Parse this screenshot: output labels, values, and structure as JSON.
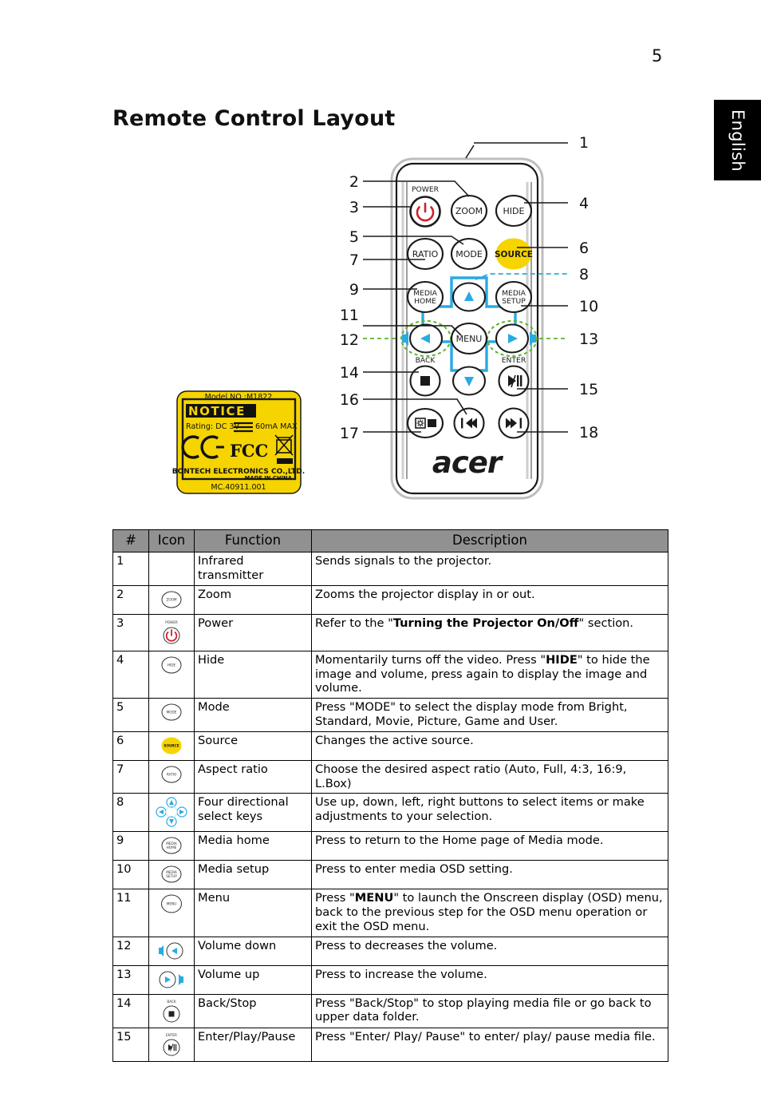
{
  "page": {
    "number": "5",
    "language_tab": "English",
    "title": "Remote Control Layout"
  },
  "figure": {
    "name": "remote-control-diagram",
    "brand_logo": "acer",
    "callouts_left": [
      {
        "n": "2",
        "style": "solid"
      },
      {
        "n": "3",
        "style": "solid"
      },
      {
        "n": "5",
        "style": "solid"
      },
      {
        "n": "7",
        "style": "solid"
      },
      {
        "n": "9",
        "style": "solid"
      },
      {
        "n": "11",
        "style": "solid"
      },
      {
        "n": "12",
        "style": "dashed-green"
      },
      {
        "n": "14",
        "style": "solid"
      },
      {
        "n": "16",
        "style": "solid"
      },
      {
        "n": "17",
        "style": "solid"
      }
    ],
    "callouts_right": [
      {
        "n": "1",
        "style": "solid"
      },
      {
        "n": "4",
        "style": "solid"
      },
      {
        "n": "6",
        "style": "solid"
      },
      {
        "n": "8",
        "style": "dashed-blue"
      },
      {
        "n": "10",
        "style": "solid"
      },
      {
        "n": "13",
        "style": "dashed-green"
      },
      {
        "n": "15",
        "style": "solid"
      },
      {
        "n": "18",
        "style": "solid"
      }
    ],
    "buttons": [
      {
        "label": "POWER",
        "type": "power-icon"
      },
      {
        "label": "ZOOM",
        "type": "text"
      },
      {
        "label": "HIDE",
        "type": "text"
      },
      {
        "label": "RATIO",
        "type": "text"
      },
      {
        "label": "MODE",
        "type": "text"
      },
      {
        "label": "SOURCE",
        "type": "text-yellow"
      },
      {
        "label": "MEDIA HOME",
        "type": "text"
      },
      {
        "label": "MEDIA SETUP",
        "type": "text"
      },
      {
        "label": "MENU",
        "type": "text"
      },
      {
        "label": "BACK",
        "type": "stop-icon"
      },
      {
        "label": "ENTER",
        "type": "play-pause-icon"
      }
    ],
    "colors": {
      "source_button": "#F5D400",
      "power_glyph": "#D0202A",
      "dpad_cyan": "#29AAE2",
      "callout_green": "#5FB22D",
      "callout_blue": "#29AAE2"
    }
  },
  "notice_label": {
    "name": "notice-sticker",
    "model_line": "Model NO :M1822",
    "notice": "NOTICE",
    "rating": "Rating: DC 3V",
    "rating_tail": "60mA MAX",
    "company": "BONTECH ELECTRONICS CO.,LTD.",
    "made_in": "MADE IN CHINA",
    "part_number": "MC.40911.001",
    "marks": [
      "CE",
      "FCC",
      "WEEE"
    ],
    "background": "#F5D400"
  },
  "table": {
    "headers": [
      "#",
      "Icon",
      "Function",
      "Description"
    ],
    "rows": [
      {
        "num": "1",
        "icon": "none",
        "function": "Infrared transmitter",
        "desc_parts": [
          {
            "t": "Sends signals to the projector.",
            "b": false
          }
        ]
      },
      {
        "num": "2",
        "icon": "zoom",
        "function": "Zoom",
        "desc_parts": [
          {
            "t": "Zooms the projector display in or out.",
            "b": false
          }
        ]
      },
      {
        "num": "3",
        "icon": "power",
        "function": "Power",
        "desc_parts": [
          {
            "t": "Refer to the \"",
            "b": false
          },
          {
            "t": "Turning the Projector On/Off",
            "b": true
          },
          {
            "t": "\" section.",
            "b": false
          }
        ]
      },
      {
        "num": "4",
        "icon": "hide",
        "function": "Hide",
        "desc_parts": [
          {
            "t": "Momentarily turns off the video. Press \"",
            "b": false
          },
          {
            "t": "HIDE",
            "b": true
          },
          {
            "t": "\" to hide the image and volume, press again to display the image and volume.",
            "b": false
          }
        ]
      },
      {
        "num": "5",
        "icon": "mode",
        "function": "Mode",
        "desc_parts": [
          {
            "t": "Press \"MODE\" to select the display mode from Bright, Standard, Movie, Picture, Game and User.",
            "b": false
          }
        ]
      },
      {
        "num": "6",
        "icon": "source",
        "function": "Source",
        "desc_parts": [
          {
            "t": "Changes the active source.",
            "b": false
          }
        ]
      },
      {
        "num": "7",
        "icon": "ratio",
        "function": "Aspect ratio",
        "desc_parts": [
          {
            "t": "Choose the desired aspect ratio (Auto, Full, 4:3, 16:9, L.Box)",
            "b": false
          }
        ]
      },
      {
        "num": "8",
        "icon": "dpad",
        "function": "Four directional select keys",
        "desc_parts": [
          {
            "t": "Use up, down, left, right buttons to select items or make adjustments to your selection.",
            "b": false
          }
        ]
      },
      {
        "num": "9",
        "icon": "media-home",
        "function": "Media home",
        "desc_parts": [
          {
            "t": "Press to return to the Home page of Media mode.",
            "b": false
          }
        ]
      },
      {
        "num": "10",
        "icon": "media-setup",
        "function": "Media setup",
        "desc_parts": [
          {
            "t": "Press to enter media OSD setting.",
            "b": false
          }
        ]
      },
      {
        "num": "11",
        "icon": "menu",
        "function": "Menu",
        "desc_parts": [
          {
            "t": "Press \"",
            "b": false
          },
          {
            "t": "MENU",
            "b": true
          },
          {
            "t": "\" to launch the Onscreen display (OSD) menu, back to the previous step for the OSD menu operation or exit the OSD menu.",
            "b": false
          }
        ]
      },
      {
        "num": "12",
        "icon": "volume-down",
        "function": "Volume down",
        "desc_parts": [
          {
            "t": "Press to decreases the volume.",
            "b": false
          }
        ]
      },
      {
        "num": "13",
        "icon": "volume-up",
        "function": "Volume up",
        "desc_parts": [
          {
            "t": "Press to increase the volume.",
            "b": false
          }
        ]
      },
      {
        "num": "14",
        "icon": "back-stop",
        "function": "Back/Stop",
        "desc_parts": [
          {
            "t": "Press \"Back/Stop\" to stop playing media file or go back to upper data folder.",
            "b": false
          }
        ]
      },
      {
        "num": "15",
        "icon": "enter-play-pause",
        "function": "Enter/Play/Pause",
        "desc_parts": [
          {
            "t": "Press \"Enter/ Play/ Pause\" to enter/ play/ pause media file.",
            "b": false
          }
        ]
      }
    ]
  }
}
